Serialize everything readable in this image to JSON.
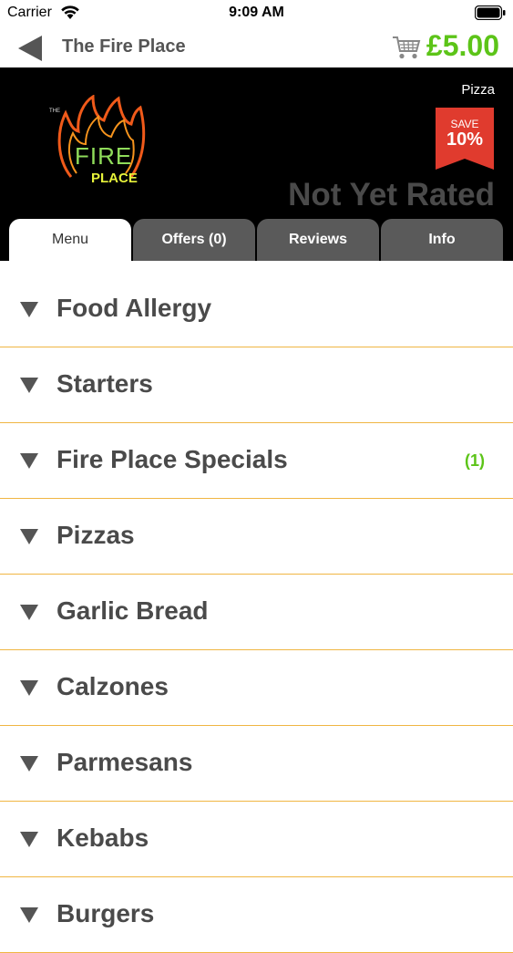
{
  "status_bar": {
    "carrier": "Carrier",
    "time": "9:09 AM"
  },
  "nav": {
    "title": "The Fire Place",
    "cart_total": "£5.00"
  },
  "header": {
    "cuisine": "Pizza",
    "save_label": "SAVE",
    "save_value": "10%",
    "rating_text": "Not Yet Rated",
    "logo_small": "THE",
    "logo_fire": "FIRE",
    "logo_place": "PLACE"
  },
  "tabs": [
    {
      "label": "Menu",
      "active": true
    },
    {
      "label": "Offers (0)"
    },
    {
      "label": "Reviews"
    },
    {
      "label": "Info"
    }
  ],
  "menu": [
    {
      "label": "Food Allergy",
      "count": ""
    },
    {
      "label": "Starters",
      "count": ""
    },
    {
      "label": "Fire Place Specials",
      "count": "(1)"
    },
    {
      "label": "Pizzas",
      "count": ""
    },
    {
      "label": "Garlic Bread",
      "count": ""
    },
    {
      "label": "Calzones",
      "count": ""
    },
    {
      "label": "Parmesans",
      "count": ""
    },
    {
      "label": "Kebabs",
      "count": ""
    },
    {
      "label": "Burgers",
      "count": ""
    }
  ],
  "colors": {
    "accent_green": "#5cc418",
    "divider_orange": "#f0b643",
    "save_red": "#e03b2e",
    "header_bg": "#000000"
  },
  "icons": [
    "wifi-icon",
    "battery-icon",
    "back-arrow-icon",
    "cart-icon",
    "expand-triangle-icon"
  ]
}
